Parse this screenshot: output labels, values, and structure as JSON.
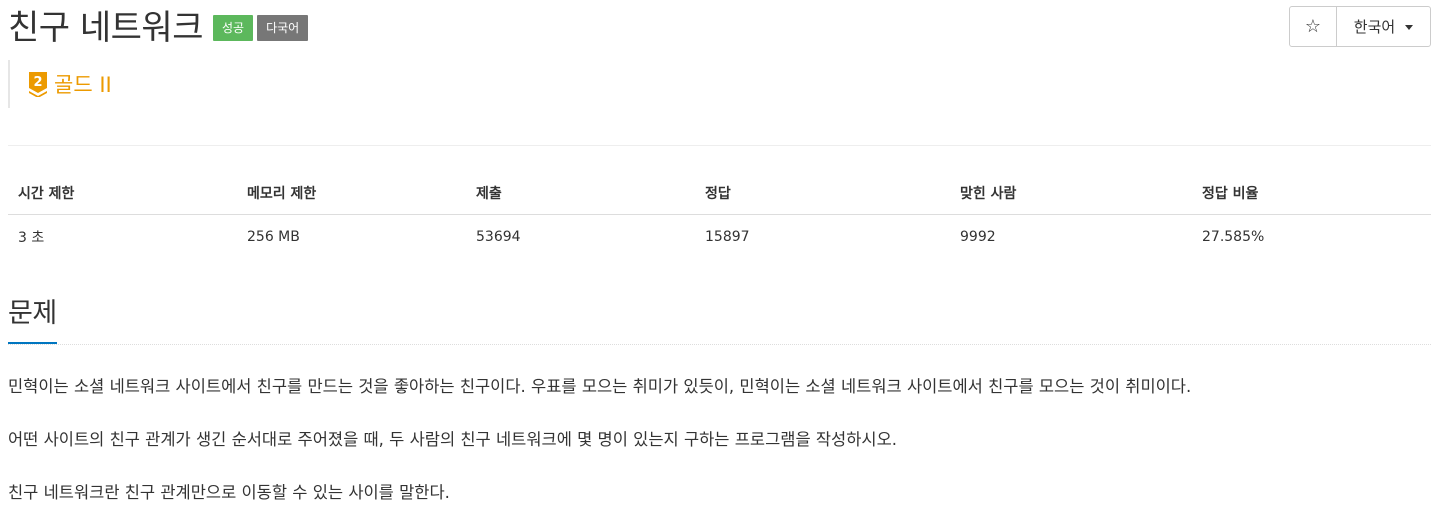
{
  "problem": {
    "title": "친구 네트워크",
    "badges": {
      "success": "성공",
      "language": "다국어"
    },
    "tier": {
      "level": "2",
      "label": "골드 II",
      "color": "#ec9a00"
    }
  },
  "controls": {
    "star_icon": "☆",
    "language_label": "한국어"
  },
  "stats": {
    "headers": [
      "시간 제한",
      "메모리 제한",
      "제출",
      "정답",
      "맞힌 사람",
      "정답 비율"
    ],
    "values": [
      "3 초",
      "256 MB",
      "53694",
      "15897",
      "9992",
      "27.585%"
    ]
  },
  "section": {
    "title": "문제"
  },
  "description": [
    "민혁이는 소셜 네트워크 사이트에서 친구를 만드는 것을 좋아하는 친구이다. 우표를 모으는 취미가 있듯이, 민혁이는 소셜 네트워크 사이트에서 친구를 모으는 것이 취미이다.",
    "어떤 사이트의 친구 관계가 생긴 순서대로 주어졌을 때, 두 사람의 친구 네트워크에 몇 명이 있는지 구하는 프로그램을 작성하시오.",
    "친구 네트워크란 친구 관계만으로 이동할 수 있는 사이를 말한다."
  ],
  "colors": {
    "success_badge": "#5cb85c",
    "language_badge": "#777777",
    "section_underline": "#0076c0"
  }
}
